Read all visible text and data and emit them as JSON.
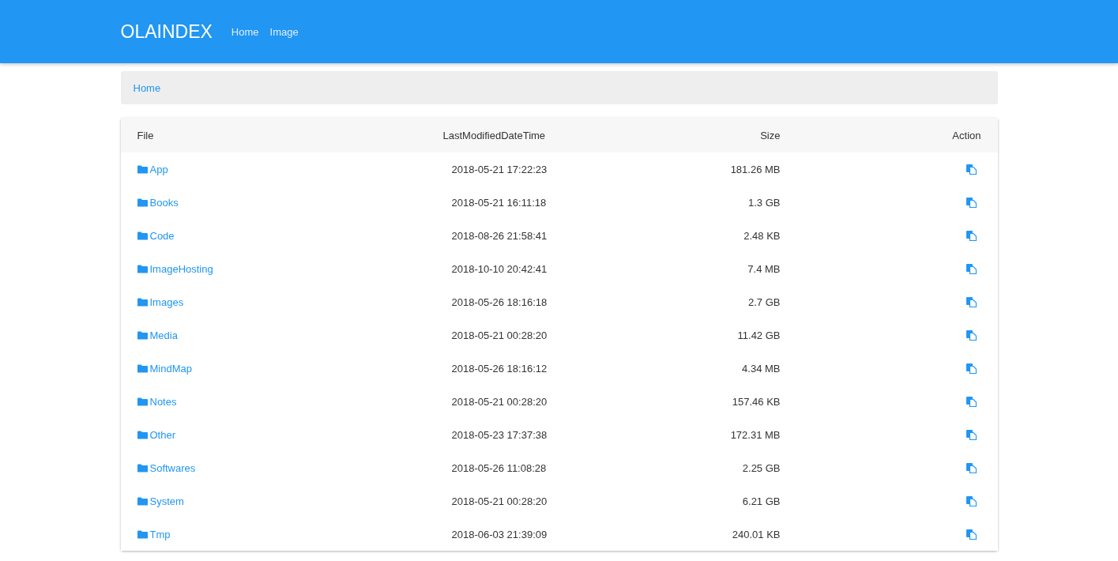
{
  "navbar": {
    "brand": "OLAINDEX",
    "links": [
      "Home",
      "Image"
    ]
  },
  "breadcrumb": [
    "Home"
  ],
  "table": {
    "columns": [
      "File",
      "LastModifiedDateTime",
      "Size",
      "Action"
    ],
    "rows": [
      {
        "name": "App",
        "modified": "2018-05-21 17:22:23",
        "size": "181.26 MB"
      },
      {
        "name": "Books",
        "modified": "2018-05-21 16:11:18",
        "size": "1.3 GB"
      },
      {
        "name": "Code",
        "modified": "2018-08-26 21:58:41",
        "size": "2.48 KB"
      },
      {
        "name": "ImageHosting",
        "modified": "2018-10-10 20:42:41",
        "size": "7.4 MB"
      },
      {
        "name": "Images",
        "modified": "2018-05-26 18:16:18",
        "size": "2.7 GB"
      },
      {
        "name": "Media",
        "modified": "2018-05-21 00:28:20",
        "size": "11.42 GB"
      },
      {
        "name": "MindMap",
        "modified": "2018-05-26 18:16:12",
        "size": "4.34 MB"
      },
      {
        "name": "Notes",
        "modified": "2018-05-21 00:28:20",
        "size": "157.46 KB"
      },
      {
        "name": "Other",
        "modified": "2018-05-23 17:37:38",
        "size": "172.31 MB"
      },
      {
        "name": "Softwares",
        "modified": "2018-05-26 11:08:28",
        "size": "2.25 GB"
      },
      {
        "name": "System",
        "modified": "2018-05-21 00:28:20",
        "size": "6.21 GB"
      },
      {
        "name": "Tmp",
        "modified": "2018-06-03 21:39:09",
        "size": "240.01 KB"
      }
    ]
  }
}
